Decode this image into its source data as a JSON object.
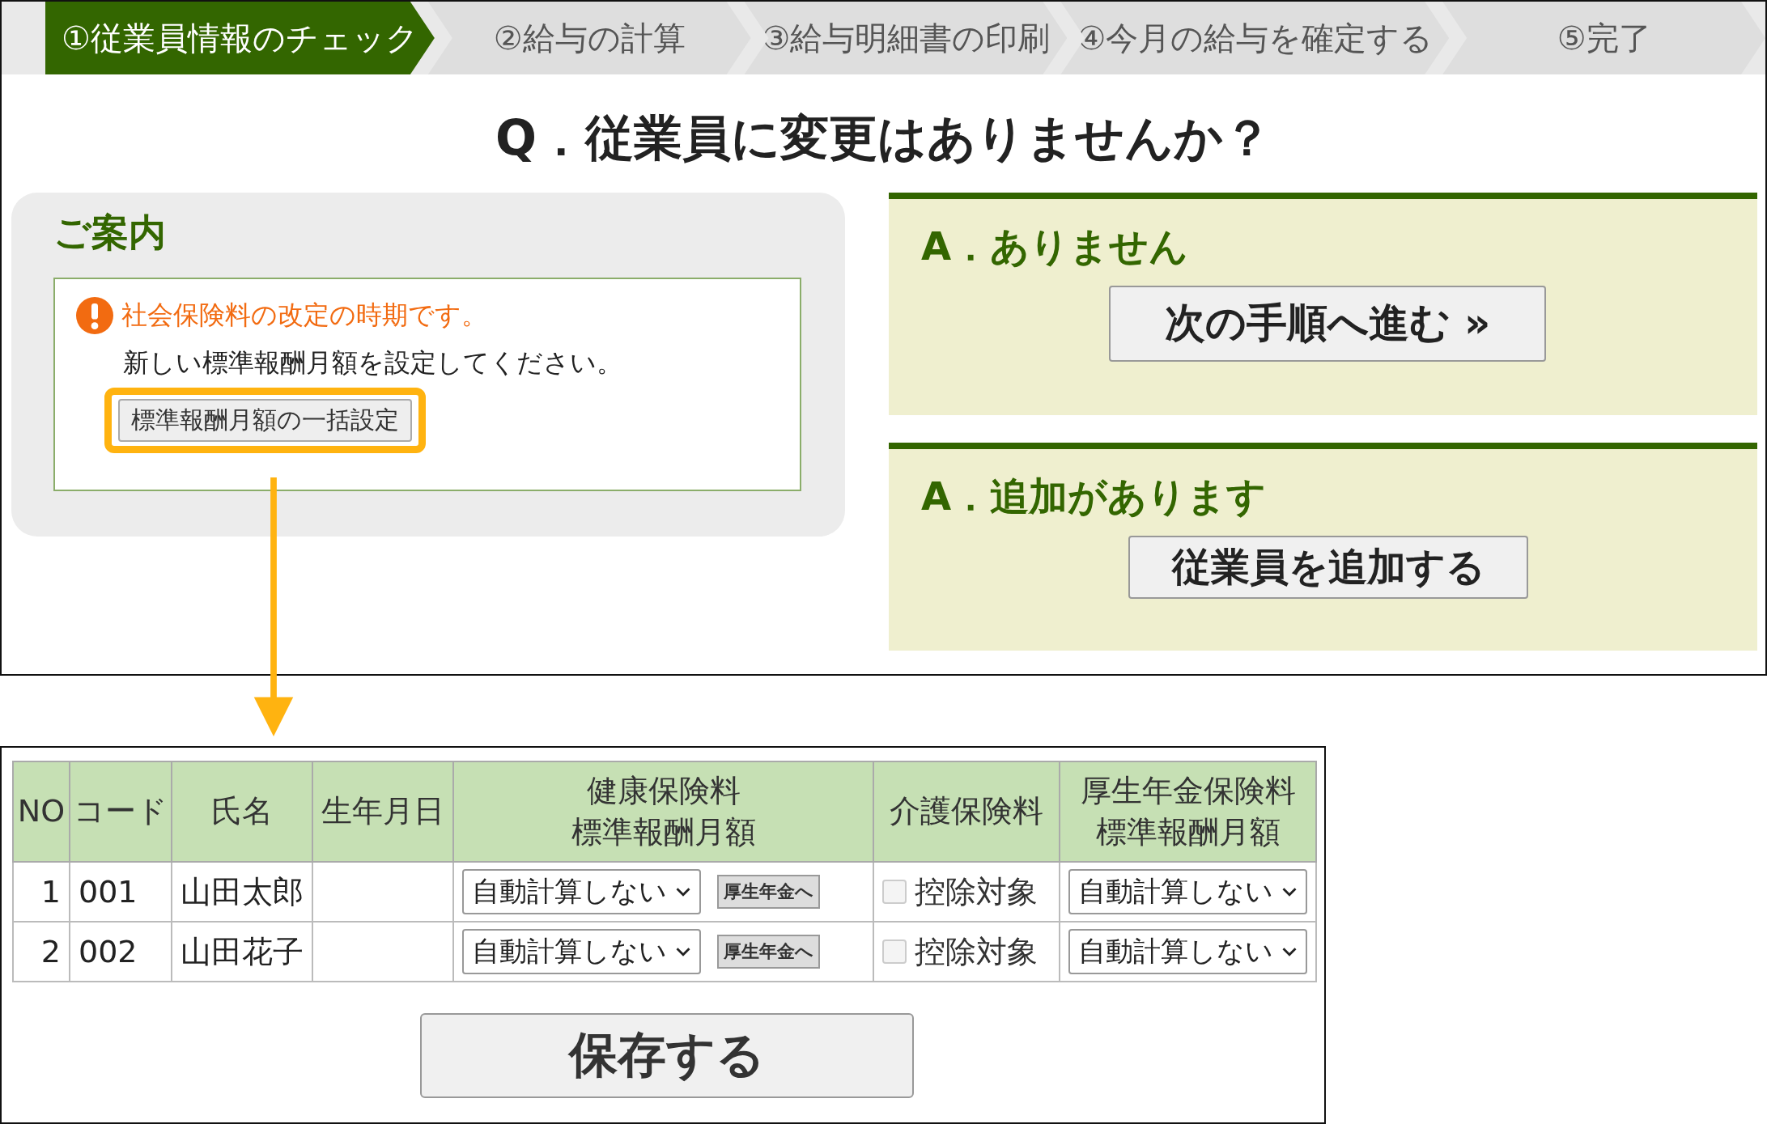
{
  "steps": [
    {
      "label": "①従業員情報のチェック",
      "selected": true
    },
    {
      "label": "②給与の計算",
      "selected": false
    },
    {
      "label": "③給与明細書の印刷",
      "selected": false
    },
    {
      "label": "④今月の給与を確定する",
      "selected": false
    },
    {
      "label": "⑤完了",
      "selected": false
    }
  ],
  "question": "Q．従業員に変更はありませんか？",
  "guide": {
    "title": "ご案内",
    "warning": "社会保険料の改定の時期です。",
    "message": "新しい標準報酬月額を設定してください。",
    "button": "標準報酬月額の一括設定"
  },
  "answers": [
    {
      "label": "A．ありません",
      "button": "次の手順へ進む »"
    },
    {
      "label": "A．追加があります",
      "button": "従業員を追加する"
    }
  ],
  "table": {
    "columns": [
      {
        "lines": [
          "NO"
        ]
      },
      {
        "lines": [
          "コード"
        ]
      },
      {
        "lines": [
          "氏名"
        ]
      },
      {
        "lines": [
          "生年月日"
        ]
      },
      {
        "lines": [
          "健康保険料",
          "標準報酬月額"
        ]
      },
      {
        "lines": [
          "介護保険料"
        ]
      },
      {
        "lines": [
          "厚生年金保険料",
          "標準報酬月額"
        ]
      }
    ],
    "rows": [
      {
        "no": "1",
        "code": "001",
        "name": "山田太郎",
        "health": "自動計算しない",
        "copy_button": "厚生年金へ",
        "care_checked": false,
        "care_disabled": true,
        "care_label": "控除対象",
        "pension": "自動計算しない"
      },
      {
        "no": "2",
        "code": "002",
        "name": "山田花子",
        "health": "自動計算しない",
        "copy_button": "厚生年金へ",
        "care_checked": false,
        "care_disabled": true,
        "care_label": "控除対象",
        "pension": "自動計算しない"
      }
    ]
  },
  "save_button": "保存する"
}
